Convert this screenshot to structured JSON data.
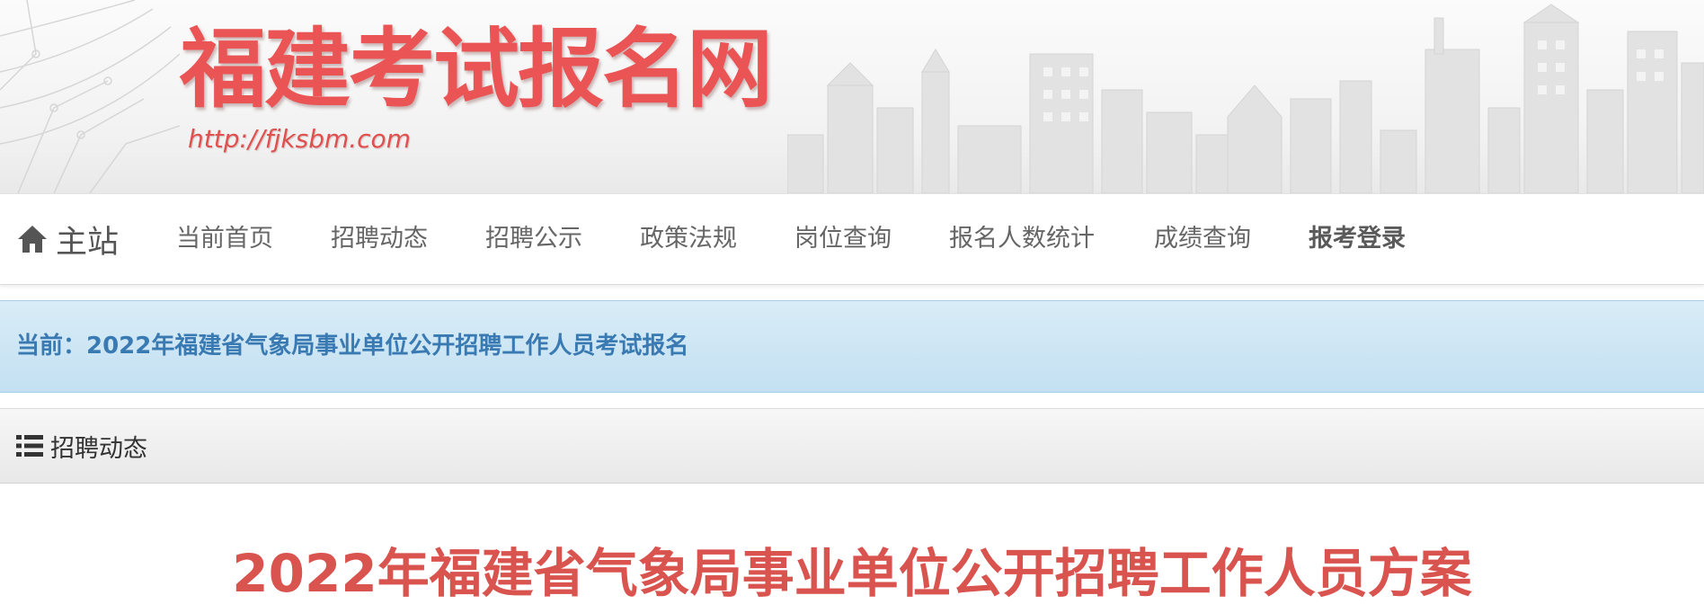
{
  "header": {
    "site_title": "福建考试报名网",
    "site_url": "http://fjksbm.com"
  },
  "nav": {
    "home_icon": "home-icon",
    "brand_label": "主站",
    "items": [
      {
        "label": "当前首页"
      },
      {
        "label": "招聘动态"
      },
      {
        "label": "招聘公示"
      },
      {
        "label": "政策法规"
      },
      {
        "label": "岗位查询"
      },
      {
        "label": "报名人数统计"
      },
      {
        "label": "成绩查询"
      },
      {
        "label": "报考登录"
      }
    ]
  },
  "current": {
    "text": "当前：2022年福建省气象局事业单位公开招聘工作人员考试报名"
  },
  "section": {
    "icon": "list-icon",
    "label": "招聘动态"
  },
  "article": {
    "title": "2022年福建省气象局事业单位公开招聘工作人员方案"
  },
  "colors": {
    "title_red": "#ea5454",
    "current_blue": "#3a7ab3",
    "article_red": "#d9534f"
  }
}
